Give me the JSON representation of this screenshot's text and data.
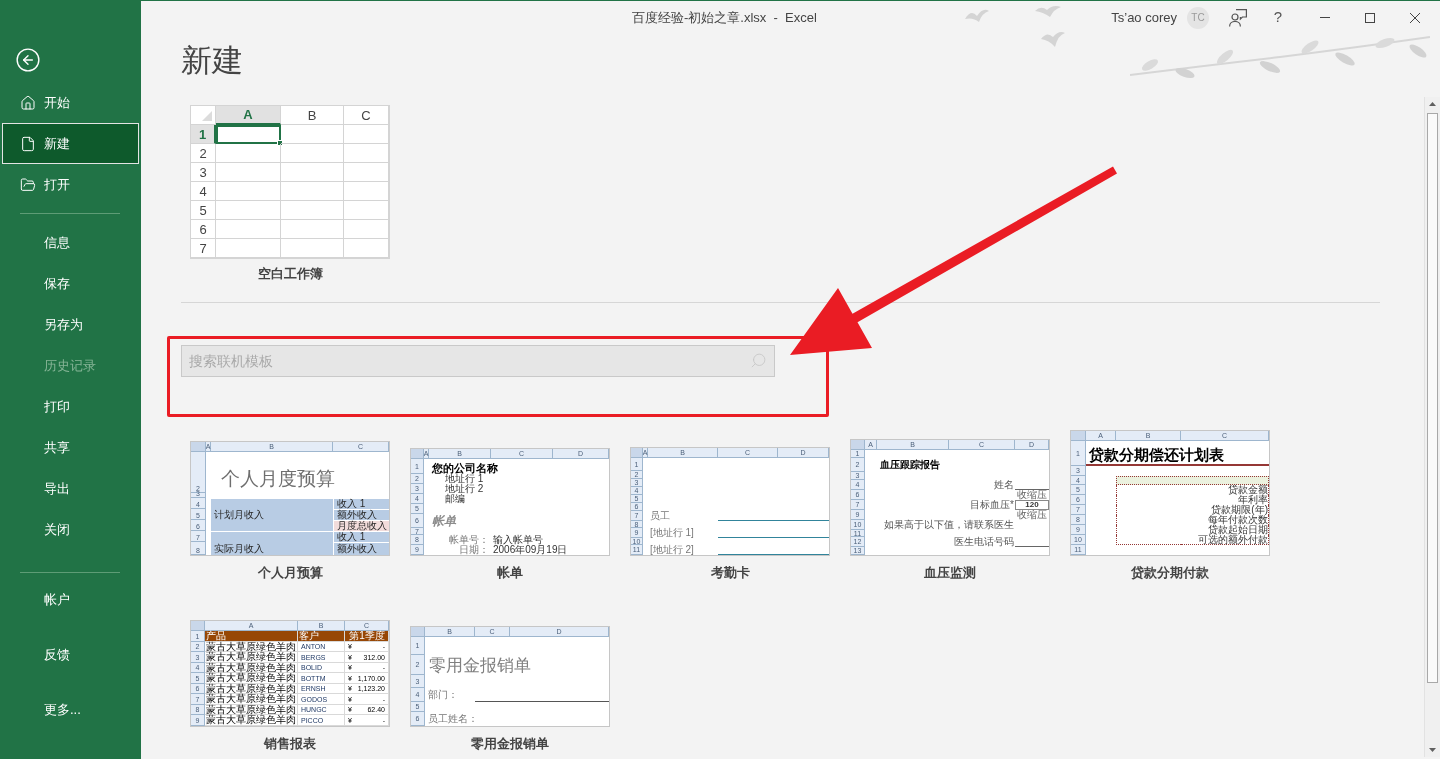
{
  "window": {
    "title": "百度经验-初始之章.xlsx  -  Excel",
    "user": "Ts’ao corey",
    "avatar": "TC",
    "help": "?"
  },
  "sidebar": {
    "groups": [
      [
        {
          "label": "开始",
          "selected": false,
          "disabled": false
        },
        {
          "label": "新建",
          "selected": true,
          "disabled": false
        },
        {
          "label": "打开",
          "selected": false,
          "disabled": false
        }
      ],
      [
        {
          "label": "信息",
          "selected": false,
          "disabled": false
        },
        {
          "label": "保存",
          "selected": false,
          "disabled": false
        },
        {
          "label": "另存为",
          "selected": false,
          "disabled": false
        },
        {
          "label": "历史记录",
          "selected": false,
          "disabled": true
        },
        {
          "label": "打印",
          "selected": false,
          "disabled": false
        },
        {
          "label": "共享",
          "selected": false,
          "disabled": false
        },
        {
          "label": "导出",
          "selected": false,
          "disabled": false
        },
        {
          "label": "关闭",
          "selected": false,
          "disabled": false
        }
      ],
      [
        {
          "label": "帐户",
          "selected": false,
          "disabled": false
        },
        {
          "label": "反馈",
          "selected": false,
          "disabled": false
        },
        {
          "label": "更多...",
          "selected": false,
          "disabled": false
        }
      ]
    ]
  },
  "page_title": "新建",
  "blank_workbook": {
    "name": "空白工作簿",
    "columns": [
      {
        "label": "A",
        "selected": true
      },
      {
        "label": "B",
        "selected": false
      },
      {
        "label": "C",
        "selected": false
      }
    ],
    "rows": [
      {
        "label": "1",
        "selected": true
      },
      {
        "label": "2",
        "selected": false
      },
      {
        "label": "3",
        "selected": false
      },
      {
        "label": "4",
        "selected": false
      },
      {
        "label": "5",
        "selected": false
      },
      {
        "label": "6",
        "selected": false
      },
      {
        "label": "7",
        "selected": false
      }
    ]
  },
  "search": {
    "placeholder": "搜索联机模板"
  },
  "templates": [
    {
      "name": "个人月预算",
      "kind": "budget",
      "columns": [
        "A",
        "B",
        "C"
      ],
      "rows": [
        {
          "row": "2",
          "b": "个人月度预算"
        },
        {
          "row": "3"
        },
        {
          "row": "4",
          "b": "计划月收入",
          "c": "收入 1"
        },
        {
          "row": "5",
          "c": "额外收入"
        },
        {
          "row": "6",
          "c": "月度总收入"
        },
        {
          "row": "7",
          "b": "实际月收入",
          "c": "收入 1"
        },
        {
          "row": "8",
          "c": "额外收入"
        }
      ]
    },
    {
      "name": "帐单",
      "kind": "invoice",
      "columns": [
        "A",
        "B",
        "C",
        "D"
      ],
      "rows": [
        {
          "row": "1",
          "b": "您的公司名称"
        },
        {
          "row": "2",
          "b": "地址行 1"
        },
        {
          "row": "3",
          "b": "地址行 2"
        },
        {
          "row": "4",
          "b": "邮编"
        },
        {
          "row": "5"
        },
        {
          "row": "6",
          "b": "帐单"
        },
        {
          "row": "7"
        },
        {
          "row": "8",
          "b": "帐单号：",
          "c": "输入帐单号"
        },
        {
          "row": "9",
          "b": "日期：",
          "c": "2006年09月19日"
        }
      ]
    },
    {
      "name": "考勤卡",
      "kind": "timecard",
      "columns": [
        "A",
        "B",
        "C",
        "D"
      ],
      "rows": [
        {
          "row": "1"
        },
        {
          "row": "2"
        },
        {
          "row": "3"
        },
        {
          "row": "4"
        },
        {
          "row": "5"
        },
        {
          "row": "6"
        },
        {
          "row": "7",
          "b": "员工"
        },
        {
          "row": "8"
        },
        {
          "row": "9",
          "b": "[地址行 1]"
        },
        {
          "row": "10"
        },
        {
          "row": "11",
          "b": "[地址行 2]"
        }
      ]
    },
    {
      "name": "血压监测",
      "kind": "blood_pressure",
      "columns": [
        "A",
        "B",
        "C",
        "D"
      ],
      "rows": [
        {
          "row": "1"
        },
        {
          "row": "2",
          "b": "血压跟踪报告"
        },
        {
          "row": "3"
        },
        {
          "row": "4",
          "c": "姓名"
        },
        {
          "row": "6",
          "d": "收缩压"
        },
        {
          "row": "7",
          "c": "目标血压*",
          "d": "120"
        },
        {
          "row": "9",
          "d": "收缩压"
        },
        {
          "row": "10",
          "b": "如果高于以下值，请联系医生"
        },
        {
          "row": "11"
        },
        {
          "row": "12",
          "c": "医生电话号码"
        },
        {
          "row": "13"
        }
      ]
    },
    {
      "name": "贷款分期付款",
      "kind": "loan",
      "columns": [
        "A",
        "B",
        "C"
      ],
      "rows": [
        {
          "row": "1",
          "a": "贷款分期偿还计划表"
        },
        {
          "row": "3"
        },
        {
          "row": "4"
        },
        {
          "row": "5",
          "c": "贷款金额"
        },
        {
          "row": "6",
          "c": "年利率"
        },
        {
          "row": "7",
          "c": "贷款期限(年)"
        },
        {
          "row": "8",
          "c": "每年付款次数"
        },
        {
          "row": "9",
          "c": "贷款起始日期"
        },
        {
          "row": "10",
          "c": "可选的额外付款"
        },
        {
          "row": "11"
        }
      ]
    },
    {
      "name": "销售报表",
      "kind": "sales",
      "columns": [
        "A",
        "B",
        "C"
      ],
      "rows": [
        {
          "row": "1",
          "a": "产品",
          "b": "客户",
          "c": "第1季度"
        },
        {
          "row": "2",
          "a": "蒙古大草原绿色羊肉",
          "b": "ANTON",
          "c": [
            "¥",
            "-"
          ]
        },
        {
          "row": "3",
          "a": "蒙古大草原绿色羊肉",
          "b": "BERGS",
          "c": [
            "¥",
            "312.00"
          ]
        },
        {
          "row": "4",
          "a": "蒙古大草原绿色羊肉",
          "b": "BOLID",
          "c": [
            "¥",
            "-"
          ]
        },
        {
          "row": "5",
          "a": "蒙古大草原绿色羊肉",
          "b": "BOTTM",
          "c": [
            "¥",
            "1,170.00"
          ]
        },
        {
          "row": "6",
          "a": "蒙古大草原绿色羊肉",
          "b": "ERNSH",
          "c": [
            "¥",
            "1,123.20"
          ]
        },
        {
          "row": "7",
          "a": "蒙古大草原绿色羊肉",
          "b": "GODOS",
          "c": [
            "¥",
            "-"
          ]
        },
        {
          "row": "8",
          "a": "蒙古大草原绿色羊肉",
          "b": "HUNGC",
          "c": [
            "¥",
            "62.40"
          ]
        },
        {
          "row": "9",
          "a": "蒙古大草原绿色羊肉",
          "b": "PICCO",
          "c": [
            "¥",
            "-"
          ]
        }
      ]
    },
    {
      "name": "零用金报销单",
      "kind": "petty_cash",
      "columns": [
        "B",
        "C",
        "D"
      ],
      "rows": [
        {
          "row": "1"
        },
        {
          "row": "2",
          "b": "零用金报销单"
        },
        {
          "row": "3"
        },
        {
          "row": "4",
          "b": "部门："
        },
        {
          "row": "5"
        },
        {
          "row": "6",
          "b": "员工姓名："
        }
      ]
    }
  ]
}
